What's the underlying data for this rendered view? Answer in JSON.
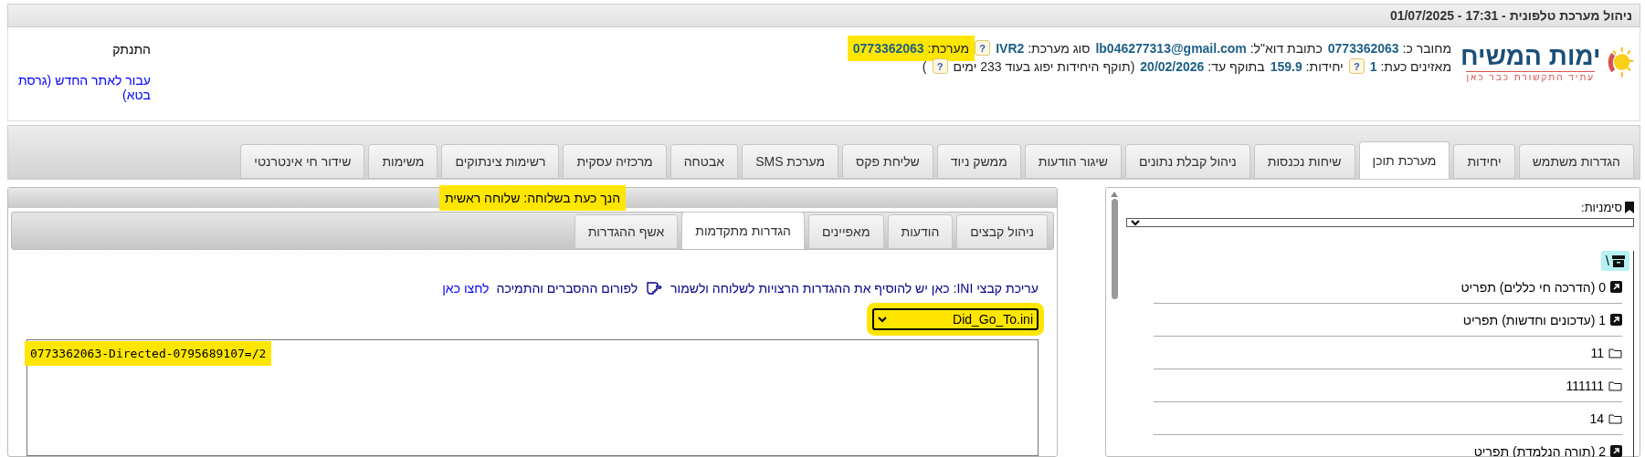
{
  "window": {
    "title": "ניהול מערכת טלפונית - 17:31 - 01/07/2025"
  },
  "logo": {
    "name": "ימות המשיח",
    "tagline": "עתיד התקשורת כבר כאן"
  },
  "info_lines": [
    [
      {
        "kind": "field",
        "label": "מחובר כ:",
        "value": "0773362063"
      },
      {
        "kind": "field",
        "label": "כתובת דוא\"ל:",
        "value": "lb046277313@gmail.com"
      },
      {
        "kind": "field",
        "label": "סוג מערכת:",
        "value": "IVR2"
      },
      {
        "kind": "help",
        "text": "?"
      },
      {
        "kind": "field",
        "label": "מערכת:",
        "value": "0773362063",
        "highlighted": true
      }
    ],
    [
      {
        "kind": "field",
        "label": "מאזינים כעת:",
        "value": "1"
      },
      {
        "kind": "help",
        "text": "?"
      },
      {
        "kind": "field",
        "label": "יחידות:",
        "value": "159.9"
      },
      {
        "kind": "field",
        "label": "בתוקף עד:",
        "value": "20/02/2026"
      },
      {
        "kind": "text",
        "text": "(תוקף היחידות יפוג בעוד 233 ימים"
      },
      {
        "kind": "help",
        "text": "?"
      },
      {
        "kind": "text",
        "text": ")"
      }
    ]
  ],
  "user_links": {
    "logout": "התנתק",
    "new_site": "עבור לאתר החדש (גרסת בטא)"
  },
  "tabs": [
    {
      "label": "הגדרות משתמש",
      "selected": false
    },
    {
      "label": "יחידות",
      "selected": false
    },
    {
      "label": "מערכת תוכן",
      "selected": true
    },
    {
      "label": "שיחות נכנסות",
      "selected": false
    },
    {
      "label": "ניהול קבלת נתונים",
      "selected": false
    },
    {
      "label": "שיגור הודעות",
      "selected": false
    },
    {
      "label": "ממשק ניוד",
      "selected": false
    },
    {
      "label": "שליחת פקס",
      "selected": false
    },
    {
      "label": "מערכת SMS",
      "selected": false
    },
    {
      "label": "אבטחה",
      "selected": false
    },
    {
      "label": "מרכזיה עסקית",
      "selected": false
    },
    {
      "label": "רשימות צינתוקים",
      "selected": false
    },
    {
      "label": "משימות",
      "selected": false
    },
    {
      "label": "שידור חי אינטרנטי",
      "selected": false
    }
  ],
  "bookmarks": {
    "label": "סימניות:",
    "tree": [
      {
        "label": "\\",
        "kind": "root",
        "selected": true,
        "children": [
          {
            "label": "0 (הדרכה חי כללים) תפריט",
            "kind": "shortcut",
            "selected": false
          },
          {
            "label": "1 (עדכונים וחדשות) תפריט",
            "kind": "shortcut",
            "selected": false
          },
          {
            "label": "11",
            "kind": "folder",
            "selected": false
          },
          {
            "label": "111111",
            "kind": "folder",
            "selected": false
          },
          {
            "label": "14",
            "kind": "folder",
            "selected": false
          },
          {
            "label": "2 (תורה הנלמדת) תפריט",
            "kind": "shortcut",
            "selected": false
          }
        ]
      }
    ]
  },
  "extension_panel": {
    "header": "הנך כעת בשלוחה: שלוחה ראשית",
    "header_highlighted": true,
    "tabs": [
      {
        "label": "ניהול קבצים",
        "selected": false
      },
      {
        "label": "הודעות",
        "selected": false
      },
      {
        "label": "מאפיינים",
        "selected": false
      },
      {
        "label": "הגדרות מתקדמות",
        "selected": true
      },
      {
        "label": "אשף ההגדרות",
        "selected": false
      }
    ],
    "instruction": "עריכת קבצי INI: כאן יש להוסיף את ההגדרות הרצויות לשלוחה ולשמור",
    "forum_text": "לפורום ההסברים והתמיכה",
    "forum_link": "לחצו כאן",
    "file_select": {
      "value": "Did_Go_To.ini",
      "highlighted": true
    },
    "editor": {
      "value": "0773362063-Directed-0795689107=/2",
      "highlighted": true
    }
  }
}
